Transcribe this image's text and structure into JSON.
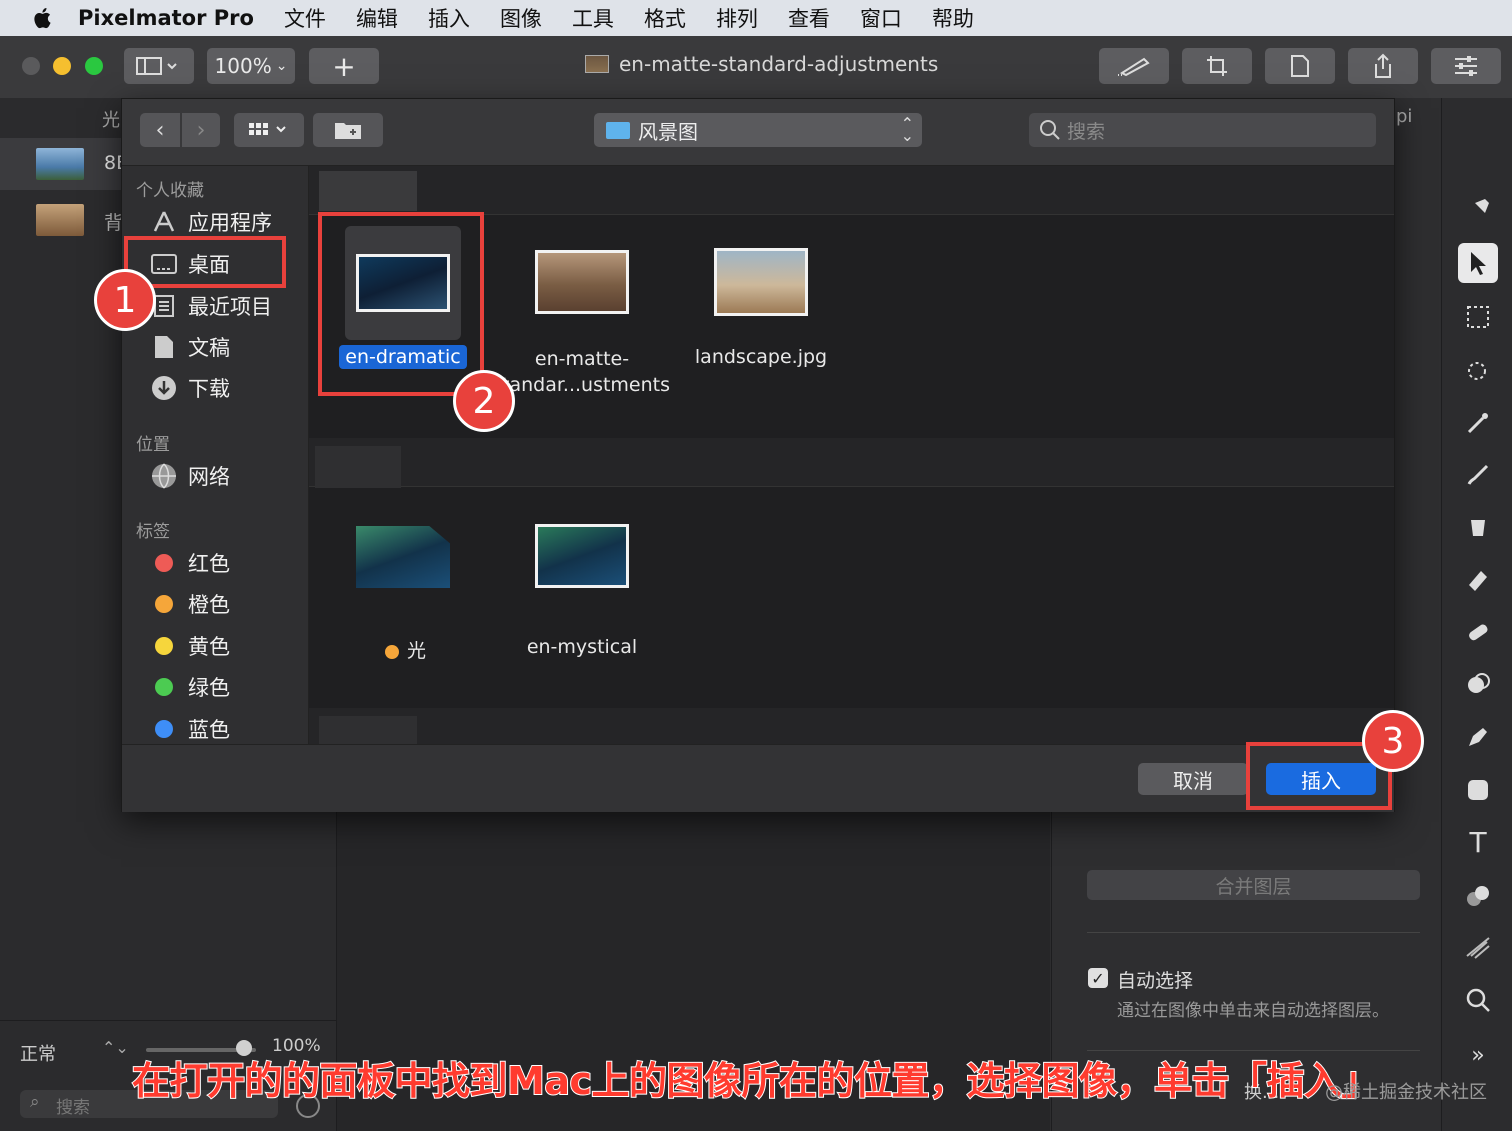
{
  "menubar": {
    "app": "Pixelmator Pro",
    "items": [
      "文件",
      "编辑",
      "插入",
      "图像",
      "工具",
      "格式",
      "排列",
      "查看",
      "窗口",
      "帮助"
    ]
  },
  "toolbar": {
    "zoom": "100%",
    "add": "+",
    "document_title": "en-matte-standard-adjustments"
  },
  "layers_panel": {
    "header_partial": "光",
    "rows": [
      {
        "label_partial": "8E"
      },
      {
        "label_partial": "背"
      }
    ],
    "blend_mode": "正常",
    "opacity": "100%",
    "search_placeholder": "搜索"
  },
  "right_panel": {
    "header_partial": "pi",
    "merge_button": "合并图层",
    "auto_select_label": "自动选择",
    "auto_select_desc": "通过在图像中单击来自动选择图层。",
    "auto_select_checked": true,
    "bottom_partial": "换..."
  },
  "dialog": {
    "location": "风景图",
    "search_placeholder": "搜索",
    "sidebar": {
      "favorites_title": "个人收藏",
      "favorites": [
        {
          "label": "应用程序",
          "icon": "applications-icon"
        },
        {
          "label": "桌面",
          "icon": "desktop-icon"
        },
        {
          "label": "最近项目",
          "icon": "recents-icon"
        },
        {
          "label": "文稿",
          "icon": "documents-icon"
        },
        {
          "label": "下载",
          "icon": "downloads-icon"
        }
      ],
      "locations_title": "位置",
      "locations": [
        {
          "label": "网络",
          "icon": "network-icon"
        }
      ],
      "tags_title": "标签",
      "tags": [
        {
          "label": "红色",
          "color": "#ee5b56"
        },
        {
          "label": "橙色",
          "color": "#f5a63a"
        },
        {
          "label": "黄色",
          "color": "#f6d63c"
        },
        {
          "label": "绿色",
          "color": "#4ccb52"
        },
        {
          "label": "蓝色",
          "color": "#3e8ef7"
        }
      ]
    },
    "files_group1": [
      {
        "name": "en-dramatic",
        "selected": true
      },
      {
        "name_line1": "en-matte-",
        "name_line2": "tandar...ustments"
      },
      {
        "name": "landscape.jpg"
      }
    ],
    "files_group2": [
      {
        "name": "光",
        "tag_color": "#f5a63a"
      },
      {
        "name": "en-mystical"
      }
    ],
    "cancel": "取消",
    "insert": "插入"
  },
  "annotations": {
    "badges": [
      "1",
      "2",
      "3"
    ],
    "caption": "在打开的的面板中找到Mac上的图像所在的位置，选择图像，单击「插入」",
    "watermark": "@稀土掘金技术社区",
    "accent": "#e8413c"
  }
}
